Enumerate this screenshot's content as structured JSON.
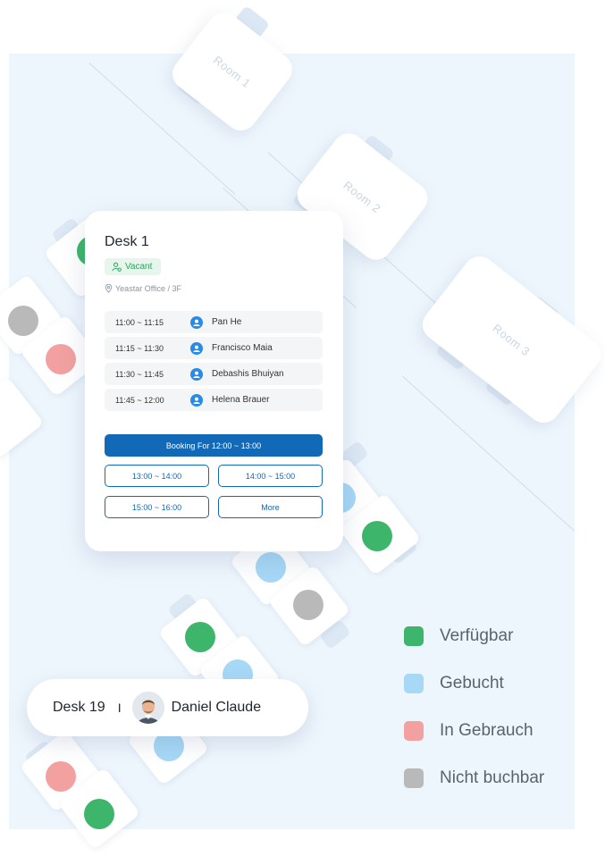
{
  "rooms": [
    {
      "label": "Room 1"
    },
    {
      "label": "Room 2"
    },
    {
      "label": "Room 3"
    }
  ],
  "desk_card": {
    "title": "Desk 1",
    "status": "Vacant",
    "location": "Yeastar Office / 3F",
    "slots": [
      {
        "time": "11:00 ~ 11:15",
        "person": "Pan He"
      },
      {
        "time": "11:15 ~ 11:30",
        "person": "Francisco Maia"
      },
      {
        "time": "11:30 ~ 11:45",
        "person": "Debashis Bhuiyan"
      },
      {
        "time": "11:45 ~ 12:00",
        "person": "Helena Brauer"
      }
    ],
    "primary_booking": "Booking For 12:00 ~ 13:00",
    "options": [
      "13:00 ~ 14:00",
      "14:00 ~ 15:00",
      "15:00 ~ 16:00",
      "More"
    ]
  },
  "desk_pill": {
    "desk": "Desk 19",
    "separator": "I",
    "person": "Daniel Claude"
  },
  "legend": [
    {
      "label": "Verfügbar",
      "color": "#3db56b"
    },
    {
      "label": "Gebucht",
      "color": "#a7d8f6"
    },
    {
      "label": "In Gebrauch",
      "color": "#f2a1a0"
    },
    {
      "label": "Nicht buchbar",
      "color": "#b9b9b9"
    }
  ],
  "colors": {
    "available": "#3db56b",
    "booked": "#a7d8f6",
    "in_use": "#f2a1a0",
    "unavailable": "#b9b9b9",
    "accent": "#1169b8"
  }
}
